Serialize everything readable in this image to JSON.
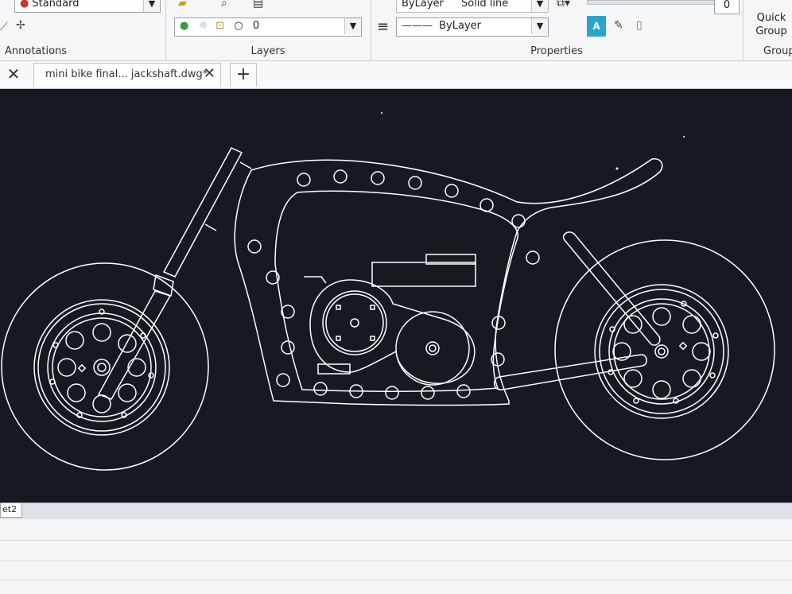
{
  "ribbon": {
    "annotations": {
      "text_style": "Standard",
      "panel_label": "Annotations"
    },
    "layers": {
      "current_layer": "0",
      "panel_label": "Layers"
    },
    "properties": {
      "color": "ByLayer",
      "linetype": "Solid line",
      "lineweight": "ByLayer",
      "transparency": "0",
      "panel_label": "Properties"
    },
    "groups": {
      "quick_group": "Quick Group",
      "panel_label": "Group"
    }
  },
  "tabs": {
    "active_document": "mini bike final... jackshaft.dwg*"
  },
  "layout_tab": {
    "label": "et2"
  },
  "colors": {
    "canvas_bg": "#141a20",
    "line": "#ffffff"
  }
}
